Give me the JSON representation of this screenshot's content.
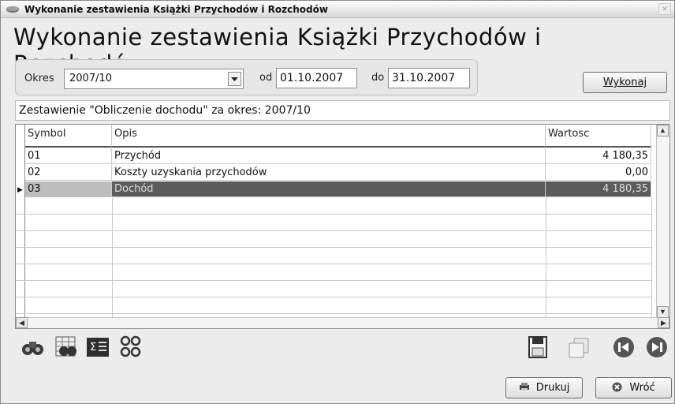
{
  "window": {
    "title": "Wykonanie zestawienia Książki Przychodów i Rozchodów",
    "close_glyph": "×"
  },
  "heading": "Wykonanie zestawienia Książki Przychodów i Rozchodów",
  "filter": {
    "period_label": "Okres",
    "period_value": "2007/10",
    "from_label": "od",
    "from_value": "01.10.2007",
    "to_label": "do",
    "to_value": "31.10.2007",
    "run_button": "Wykonaj"
  },
  "summary_text": "Zestawienie \"Obliczenie dochodu\" za okres: 2007/10",
  "table": {
    "columns": [
      "Symbol",
      "Opis",
      "Wartosc"
    ],
    "rows": [
      {
        "symbol": "01",
        "opis": "Przychód",
        "wartosc": "4 180,35"
      },
      {
        "symbol": "02",
        "opis": "Koszty uzyskania przychodów",
        "wartosc": "0,00"
      },
      {
        "symbol": "03",
        "opis": "Dochód",
        "wartosc": "4 180,35"
      }
    ],
    "selected_row_index": 2
  },
  "toolbar": {
    "icons": [
      "binoculars-icon",
      "table-search-icon",
      "sum-icon",
      "filter-group-icon",
      "save-icon",
      "copy-icon",
      "prev-icon",
      "next-icon"
    ]
  },
  "footer": {
    "print_button": "Drukuj",
    "back_button": "Wróć"
  },
  "colors": {
    "selected_row_bg": "#5c5c5c",
    "window_bg": "#ececec"
  }
}
